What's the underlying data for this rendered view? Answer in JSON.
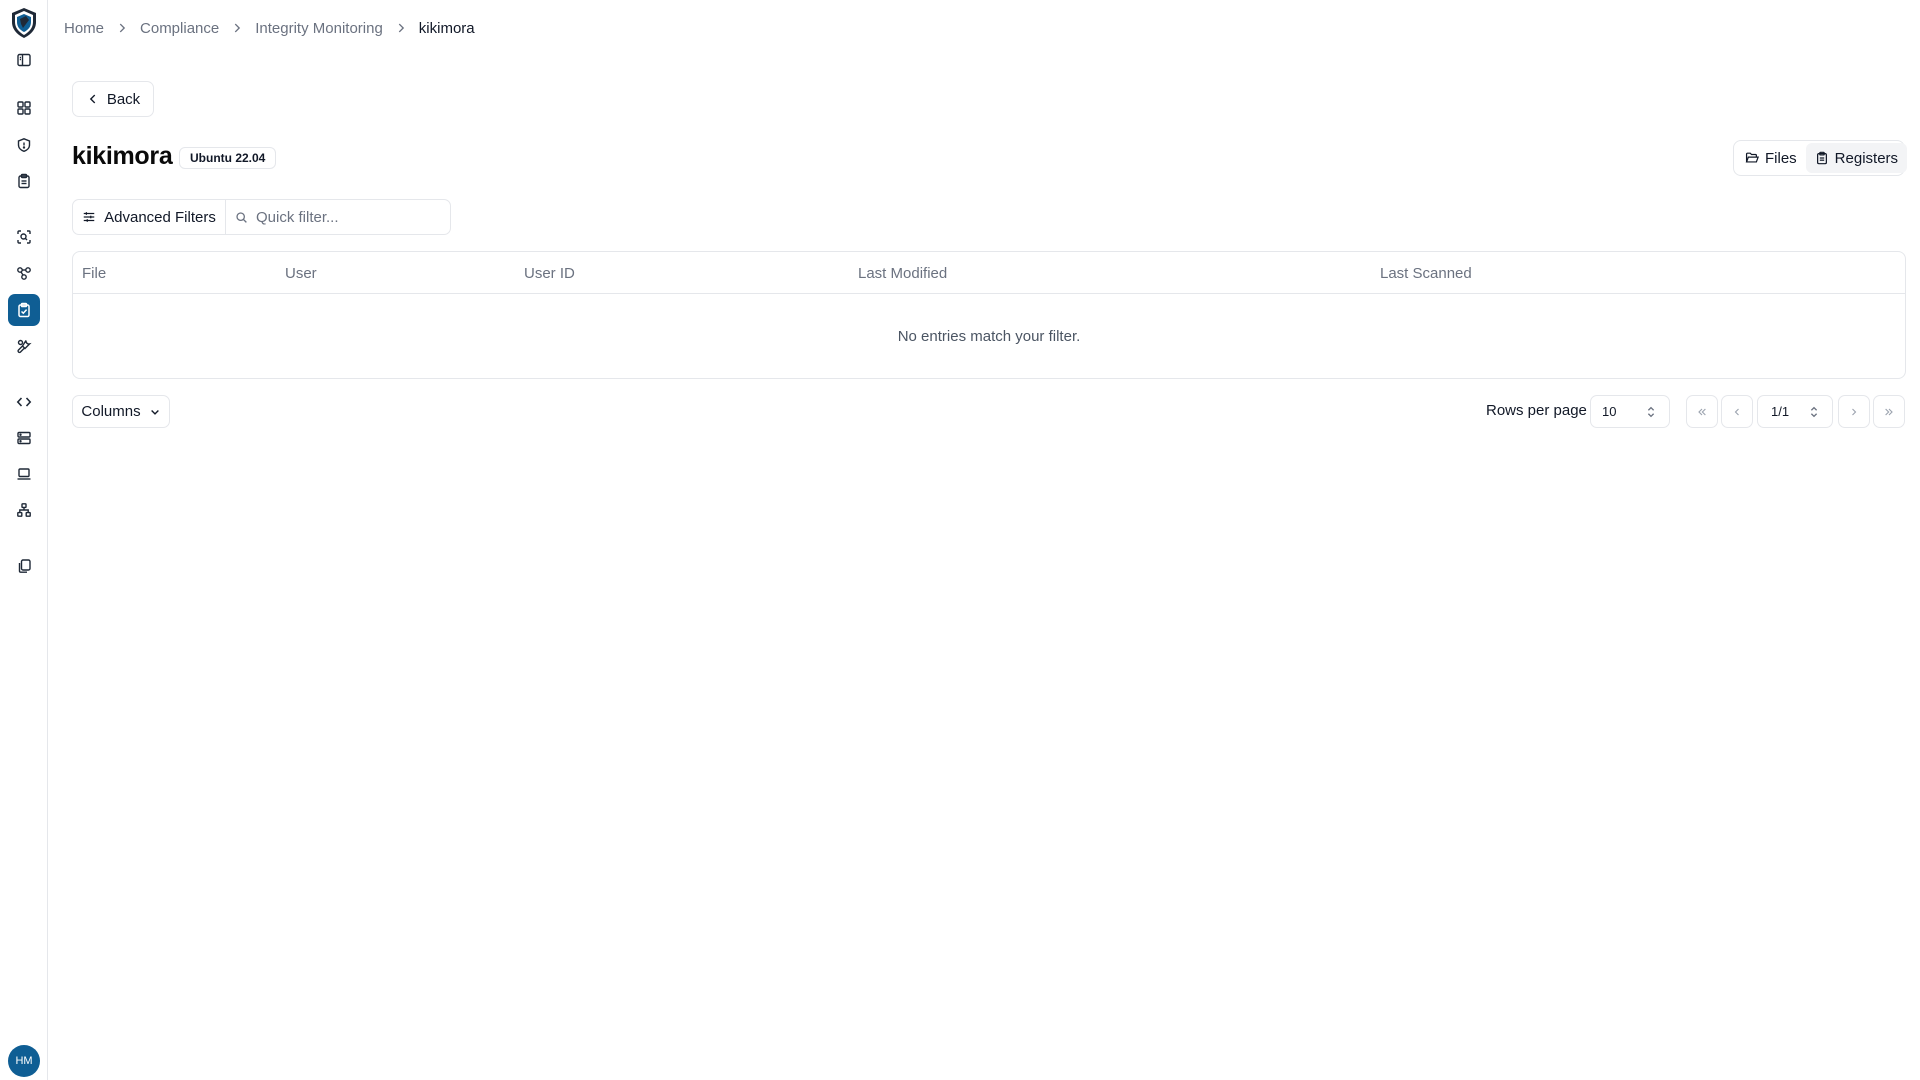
{
  "colors": {
    "accent": "#0f5e94",
    "border": "#e5e7eb",
    "muted": "#6b7280"
  },
  "sidebar": {
    "items": [
      {
        "icon": "panel-toggle-icon"
      },
      {
        "icon": "dashboard-icon"
      },
      {
        "icon": "shield-icon"
      },
      {
        "icon": "clipboard-icon"
      },
      {
        "icon": "scan-icon"
      },
      {
        "icon": "nodes-icon"
      },
      {
        "icon": "clipboard-check-icon",
        "active": true
      },
      {
        "icon": "tools-icon"
      },
      {
        "icon": "code-icon"
      },
      {
        "icon": "server-icon"
      },
      {
        "icon": "laptop-icon"
      },
      {
        "icon": "network-icon"
      },
      {
        "icon": "copy-icon"
      }
    ],
    "avatar": "HM"
  },
  "breadcrumb": [
    "Home",
    "Compliance",
    "Integrity Monitoring",
    "kikimora"
  ],
  "back_label": "Back",
  "title": "kikimora",
  "os_badge": "Ubuntu 22.04",
  "view_toggle": {
    "files": "Files",
    "registers": "Registers",
    "active": "registers"
  },
  "filters": {
    "advanced": "Advanced Filters",
    "placeholder": "Quick filter...",
    "value": ""
  },
  "table": {
    "columns": [
      "File",
      "User",
      "User ID",
      "Last Modified",
      "Last Scanned"
    ],
    "rows": [],
    "empty_message": "No entries match your filter."
  },
  "pagination": {
    "columns_label": "Columns",
    "rows_per_page_label": "Rows per page",
    "rows_per_page": "10",
    "page": "1/1"
  }
}
